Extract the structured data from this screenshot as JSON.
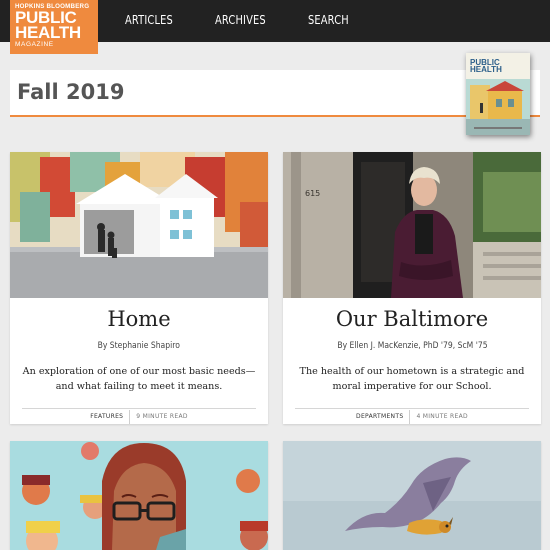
{
  "header": {
    "logo": {
      "top": "HOPKINS BLOOMBERG",
      "line1": "PUBLIC",
      "line2": "HEALTH",
      "sub": "MAGAZINE"
    },
    "nav": [
      {
        "label": "ARTICLES"
      },
      {
        "label": "ARCHIVES"
      },
      {
        "label": "SEARCH"
      }
    ]
  },
  "issue": {
    "title": "Fall 2019",
    "cover_title": "PUBLIC\nHEALTH"
  },
  "articles": [
    {
      "title": "Home",
      "byline": "By Stephanie Shapiro",
      "description": "An exploration of one of our most basic needs—and what failing to meet it means.",
      "section": "FEATURES",
      "read_time": "9 MINUTE READ"
    },
    {
      "title": "Our Baltimore",
      "byline": "By Ellen J. MacKenzie, PhD '79, ScM '75",
      "description": "The health of our hometown is a strategic and moral imperative for our School.",
      "section": "DEPARTMENTS",
      "read_time": "4 MINUTE READ"
    }
  ],
  "colors": {
    "accent": "#ef8a3e",
    "topbar": "#222222",
    "background": "#ececec"
  }
}
